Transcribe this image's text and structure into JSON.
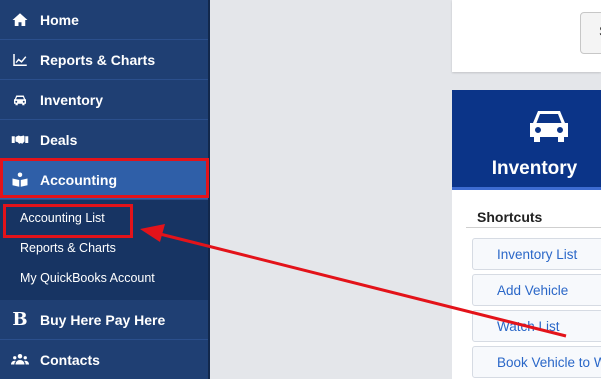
{
  "sidebar": {
    "items": [
      {
        "label": "Home",
        "icon": "home-icon"
      },
      {
        "label": "Reports & Charts",
        "icon": "chart-line-icon"
      },
      {
        "label": "Inventory",
        "icon": "car-icon"
      },
      {
        "label": "Deals",
        "icon": "handshake-icon"
      },
      {
        "label": "Accounting",
        "icon": "book-reader-icon"
      },
      {
        "label": "Buy Here Pay Here",
        "icon": "bold-b-icon"
      },
      {
        "label": "Contacts",
        "icon": "users-icon"
      }
    ],
    "accounting_submenu": [
      "Accounting List",
      "Reports & Charts",
      "My QuickBooks Account"
    ]
  },
  "top_card": {
    "button_label": "S"
  },
  "inventory_card": {
    "title": "Inventory",
    "icon": "car-icon",
    "shortcuts_title": "Shortcuts",
    "shortcuts": [
      "Inventory List",
      "Add Vehicle",
      "Watch List",
      "Book Vehicle to W"
    ]
  },
  "colors": {
    "sidebar_bg": "#1f3f73",
    "active_item": "#2f5fa8",
    "card_header": "#0b3488",
    "highlight": "#e3131a",
    "link": "#2a67c8"
  }
}
